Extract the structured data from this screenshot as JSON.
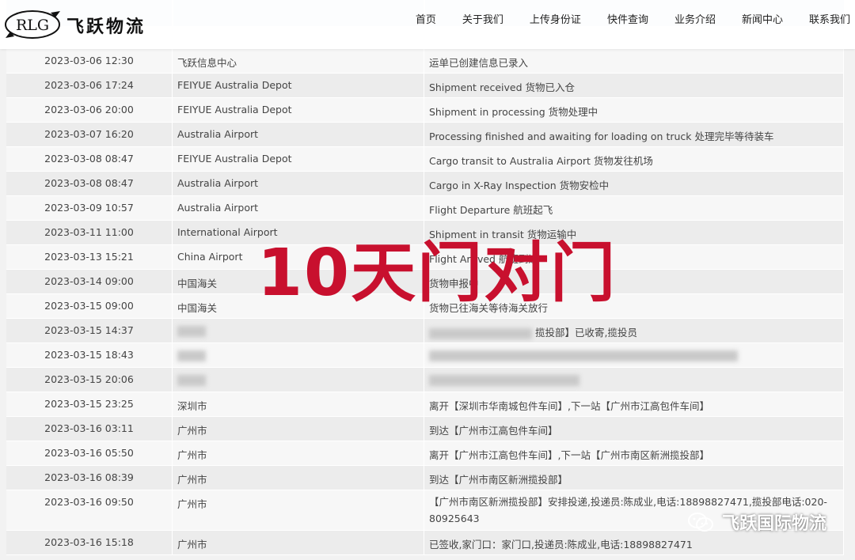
{
  "brand": {
    "logo_letters": "RLG",
    "name_cn": "飞跃物流"
  },
  "nav": {
    "items": [
      "首页",
      "关于我们",
      "上传身份证",
      "快件查询",
      "业务介绍",
      "新闻中心",
      "联系我们"
    ]
  },
  "tracking": {
    "rows": [
      {
        "time": "2023-03-06 12:30",
        "location": "飞跃信息中心",
        "description": "运单已创建信息已录入"
      },
      {
        "time": "2023-03-06 17:24",
        "location": "FEIYUE Australia Depot",
        "description": "Shipment received 货物已入仓"
      },
      {
        "time": "2023-03-06 20:00",
        "location": "FEIYUE Australia Depot",
        "description": "Shipment in processing 货物处理中"
      },
      {
        "time": "2023-03-07 16:20",
        "location": "Australia Airport",
        "description": "Processing finished and awaiting for loading on truck 处理完毕等待装车"
      },
      {
        "time": "2023-03-08 08:47",
        "location": "FEIYUE Australia Depot",
        "description": "Cargo transit to Australia Airport 货物发往机场"
      },
      {
        "time": "2023-03-08 08:47",
        "location": "Australia Airport",
        "description": "Cargo in X-Ray Inspection 货物安检中"
      },
      {
        "time": "2023-03-09 10:57",
        "location": "Australia Airport",
        "description": "Flight Departure 航班起飞"
      },
      {
        "time": "2023-03-11 11:00",
        "location": "International Airport",
        "description": "Shipment in transit 货物运输中"
      },
      {
        "time": "2023-03-13 15:21",
        "location": "China Airport",
        "description": "Flight Arrived 航班到达"
      },
      {
        "time": "2023-03-14 09:00",
        "location": "中国海关",
        "description": "货物申报中"
      },
      {
        "time": "2023-03-15 09:00",
        "location": "中国海关",
        "description": "货物已往海关等待海关放行"
      },
      {
        "time": "2023-03-15 14:37",
        "location": "",
        "description": "揽投部】已收寄,揽投员"
      },
      {
        "time": "2023-03-15 18:43",
        "location": "",
        "description": ""
      },
      {
        "time": "2023-03-15 20:06",
        "location": "",
        "description": ""
      },
      {
        "time": "2023-03-15 23:25",
        "location": "深圳市",
        "description": "离开【深圳市华南城包件车间】,下一站【广州市江高包件车间】"
      },
      {
        "time": "2023-03-16 03:11",
        "location": "广州市",
        "description": "到达【广州市江高包件车间】"
      },
      {
        "time": "2023-03-16 05:50",
        "location": "广州市",
        "description": "离开【广州市江高包件车间】,下一站【广州市南区新洲揽投部】"
      },
      {
        "time": "2023-03-16 08:39",
        "location": "广州市",
        "description": "到达【广州市南区新洲揽投部】"
      },
      {
        "time": "2023-03-16 09:50",
        "location": "广州市",
        "description": "【广州市南区新洲揽投部】安排投递,投递员:陈成业,电话:18898827471,揽投部电话:020-80925643"
      },
      {
        "time": "2023-03-16 15:18",
        "location": "广州市",
        "description": "已签收,家门口：家门口,投递员:陈成业,电话:18898827471"
      }
    ]
  },
  "overlay": {
    "text": "10天门对门",
    "color": "#c8102e"
  },
  "watermark": {
    "text": "飞跃国际物流"
  }
}
